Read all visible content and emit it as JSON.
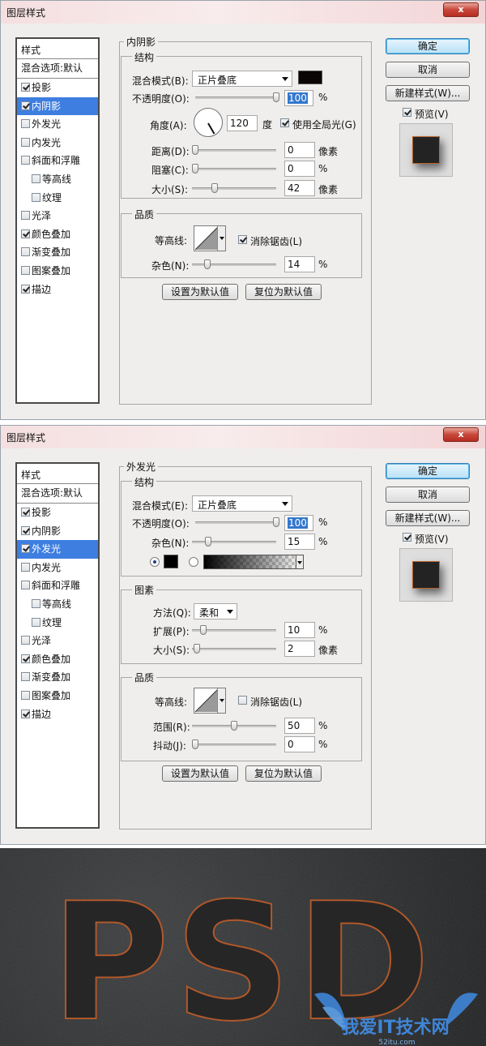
{
  "dialog1": {
    "title": "图层样式",
    "close_label": "x",
    "styles_header": "样式",
    "items": [
      {
        "label": "混合选项:默认",
        "type": "blend"
      },
      {
        "label": "投影",
        "checked": true
      },
      {
        "label": "内阴影",
        "checked": true,
        "selected": true
      },
      {
        "label": "外发光",
        "checked": false
      },
      {
        "label": "内发光",
        "checked": false
      },
      {
        "label": "斜面和浮雕",
        "checked": false
      },
      {
        "label": "等高线",
        "checked": false,
        "sub": true
      },
      {
        "label": "纹理",
        "checked": false,
        "sub": true
      },
      {
        "label": "光泽",
        "checked": false
      },
      {
        "label": "颜色叠加",
        "checked": true
      },
      {
        "label": "渐变叠加",
        "checked": false
      },
      {
        "label": "图案叠加",
        "checked": false
      },
      {
        "label": "描边",
        "checked": true
      }
    ],
    "section_title": "内阴影",
    "structure": {
      "title": "结构",
      "blend_mode_label": "混合模式(B):",
      "blend_mode_value": "正片叠底",
      "blend_color": "#0a0605",
      "opacity_label": "不透明度(O):",
      "opacity_value": "100",
      "opacity_unit": "%",
      "angle_label": "角度(A):",
      "angle_value": "120",
      "angle_unit": "度",
      "global_light_label": "使用全局光(G)",
      "global_light_checked": true,
      "distance_label": "距离(D):",
      "distance_value": "0",
      "distance_unit": "像素",
      "choke_label": "阻塞(C):",
      "choke_value": "0",
      "choke_unit": "%",
      "size_label": "大小(S):",
      "size_value": "42",
      "size_unit": "像素"
    },
    "quality": {
      "title": "品质",
      "contour_label": "等高线:",
      "antialias_label": "消除锯齿(L)",
      "antialias_checked": true,
      "noise_label": "杂色(N):",
      "noise_value": "14",
      "noise_unit": "%"
    },
    "buttons": {
      "make_default": "设置为默认值",
      "reset_default": "复位为默认值",
      "ok": "确定",
      "cancel": "取消",
      "new_style": "新建样式(W)...",
      "preview_label": "预览(V)"
    }
  },
  "dialog2": {
    "title": "图层样式",
    "close_label": "x",
    "styles_header": "样式",
    "items": [
      {
        "label": "混合选项:默认",
        "type": "blend"
      },
      {
        "label": "投影",
        "checked": true
      },
      {
        "label": "内阴影",
        "checked": true
      },
      {
        "label": "外发光",
        "checked": true,
        "selected": true
      },
      {
        "label": "内发光",
        "checked": false
      },
      {
        "label": "斜面和浮雕",
        "checked": false
      },
      {
        "label": "等高线",
        "checked": false,
        "sub": true
      },
      {
        "label": "纹理",
        "checked": false,
        "sub": true
      },
      {
        "label": "光泽",
        "checked": false
      },
      {
        "label": "颜色叠加",
        "checked": true
      },
      {
        "label": "渐变叠加",
        "checked": false
      },
      {
        "label": "图案叠加",
        "checked": false
      },
      {
        "label": "描边",
        "checked": true
      }
    ],
    "section_title": "外发光",
    "structure": {
      "title": "结构",
      "blend_mode_label": "混合模式(E):",
      "blend_mode_value": "正片叠底",
      "opacity_label": "不透明度(O):",
      "opacity_value": "100",
      "opacity_unit": "%",
      "noise_label": "杂色(N):",
      "noise_value": "15",
      "noise_unit": "%",
      "color_swatch": "#000000"
    },
    "elements": {
      "title": "图素",
      "technique_label": "方法(Q):",
      "technique_value": "柔和",
      "spread_label": "扩展(P):",
      "spread_value": "10",
      "spread_unit": "%",
      "size_label": "大小(S):",
      "size_value": "2",
      "size_unit": "像素"
    },
    "quality": {
      "title": "品质",
      "contour_label": "等高线:",
      "antialias_label": "消除锯齿(L)",
      "antialias_checked": false,
      "range_label": "范围(R):",
      "range_value": "50",
      "range_unit": "%",
      "jitter_label": "抖动(J):",
      "jitter_value": "0",
      "jitter_unit": "%"
    },
    "buttons": {
      "make_default": "设置为默认值",
      "reset_default": "复位为默认值",
      "ok": "确定",
      "cancel": "取消",
      "new_style": "新建样式(W)...",
      "preview_label": "预览(V)"
    }
  },
  "artwork": {
    "text": "PSD",
    "text_color": "#262626",
    "stroke_color": "#b0582a",
    "watermark_text": "我爱IT技术网",
    "watermark_url": "52itu.com"
  }
}
